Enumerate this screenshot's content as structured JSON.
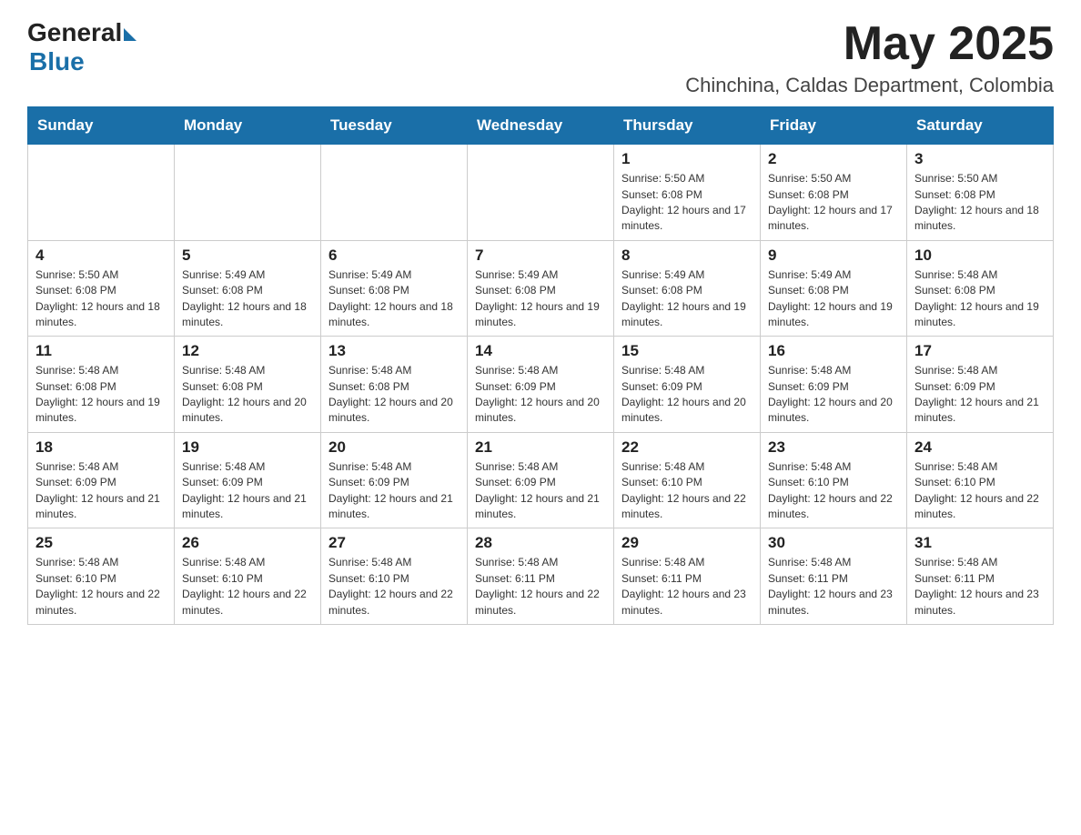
{
  "header": {
    "logo_general": "General",
    "logo_blue": "Blue",
    "title": "May 2025",
    "subtitle": "Chinchina, Caldas Department, Colombia"
  },
  "weekdays": [
    "Sunday",
    "Monday",
    "Tuesday",
    "Wednesday",
    "Thursday",
    "Friday",
    "Saturday"
  ],
  "weeks": [
    [
      {
        "day": "",
        "info": ""
      },
      {
        "day": "",
        "info": ""
      },
      {
        "day": "",
        "info": ""
      },
      {
        "day": "",
        "info": ""
      },
      {
        "day": "1",
        "info": "Sunrise: 5:50 AM\nSunset: 6:08 PM\nDaylight: 12 hours and 17 minutes."
      },
      {
        "day": "2",
        "info": "Sunrise: 5:50 AM\nSunset: 6:08 PM\nDaylight: 12 hours and 17 minutes."
      },
      {
        "day": "3",
        "info": "Sunrise: 5:50 AM\nSunset: 6:08 PM\nDaylight: 12 hours and 18 minutes."
      }
    ],
    [
      {
        "day": "4",
        "info": "Sunrise: 5:50 AM\nSunset: 6:08 PM\nDaylight: 12 hours and 18 minutes."
      },
      {
        "day": "5",
        "info": "Sunrise: 5:49 AM\nSunset: 6:08 PM\nDaylight: 12 hours and 18 minutes."
      },
      {
        "day": "6",
        "info": "Sunrise: 5:49 AM\nSunset: 6:08 PM\nDaylight: 12 hours and 18 minutes."
      },
      {
        "day": "7",
        "info": "Sunrise: 5:49 AM\nSunset: 6:08 PM\nDaylight: 12 hours and 19 minutes."
      },
      {
        "day": "8",
        "info": "Sunrise: 5:49 AM\nSunset: 6:08 PM\nDaylight: 12 hours and 19 minutes."
      },
      {
        "day": "9",
        "info": "Sunrise: 5:49 AM\nSunset: 6:08 PM\nDaylight: 12 hours and 19 minutes."
      },
      {
        "day": "10",
        "info": "Sunrise: 5:48 AM\nSunset: 6:08 PM\nDaylight: 12 hours and 19 minutes."
      }
    ],
    [
      {
        "day": "11",
        "info": "Sunrise: 5:48 AM\nSunset: 6:08 PM\nDaylight: 12 hours and 19 minutes."
      },
      {
        "day": "12",
        "info": "Sunrise: 5:48 AM\nSunset: 6:08 PM\nDaylight: 12 hours and 20 minutes."
      },
      {
        "day": "13",
        "info": "Sunrise: 5:48 AM\nSunset: 6:08 PM\nDaylight: 12 hours and 20 minutes."
      },
      {
        "day": "14",
        "info": "Sunrise: 5:48 AM\nSunset: 6:09 PM\nDaylight: 12 hours and 20 minutes."
      },
      {
        "day": "15",
        "info": "Sunrise: 5:48 AM\nSunset: 6:09 PM\nDaylight: 12 hours and 20 minutes."
      },
      {
        "day": "16",
        "info": "Sunrise: 5:48 AM\nSunset: 6:09 PM\nDaylight: 12 hours and 20 minutes."
      },
      {
        "day": "17",
        "info": "Sunrise: 5:48 AM\nSunset: 6:09 PM\nDaylight: 12 hours and 21 minutes."
      }
    ],
    [
      {
        "day": "18",
        "info": "Sunrise: 5:48 AM\nSunset: 6:09 PM\nDaylight: 12 hours and 21 minutes."
      },
      {
        "day": "19",
        "info": "Sunrise: 5:48 AM\nSunset: 6:09 PM\nDaylight: 12 hours and 21 minutes."
      },
      {
        "day": "20",
        "info": "Sunrise: 5:48 AM\nSunset: 6:09 PM\nDaylight: 12 hours and 21 minutes."
      },
      {
        "day": "21",
        "info": "Sunrise: 5:48 AM\nSunset: 6:09 PM\nDaylight: 12 hours and 21 minutes."
      },
      {
        "day": "22",
        "info": "Sunrise: 5:48 AM\nSunset: 6:10 PM\nDaylight: 12 hours and 22 minutes."
      },
      {
        "day": "23",
        "info": "Sunrise: 5:48 AM\nSunset: 6:10 PM\nDaylight: 12 hours and 22 minutes."
      },
      {
        "day": "24",
        "info": "Sunrise: 5:48 AM\nSunset: 6:10 PM\nDaylight: 12 hours and 22 minutes."
      }
    ],
    [
      {
        "day": "25",
        "info": "Sunrise: 5:48 AM\nSunset: 6:10 PM\nDaylight: 12 hours and 22 minutes."
      },
      {
        "day": "26",
        "info": "Sunrise: 5:48 AM\nSunset: 6:10 PM\nDaylight: 12 hours and 22 minutes."
      },
      {
        "day": "27",
        "info": "Sunrise: 5:48 AM\nSunset: 6:10 PM\nDaylight: 12 hours and 22 minutes."
      },
      {
        "day": "28",
        "info": "Sunrise: 5:48 AM\nSunset: 6:11 PM\nDaylight: 12 hours and 22 minutes."
      },
      {
        "day": "29",
        "info": "Sunrise: 5:48 AM\nSunset: 6:11 PM\nDaylight: 12 hours and 23 minutes."
      },
      {
        "day": "30",
        "info": "Sunrise: 5:48 AM\nSunset: 6:11 PM\nDaylight: 12 hours and 23 minutes."
      },
      {
        "day": "31",
        "info": "Sunrise: 5:48 AM\nSunset: 6:11 PM\nDaylight: 12 hours and 23 minutes."
      }
    ]
  ]
}
